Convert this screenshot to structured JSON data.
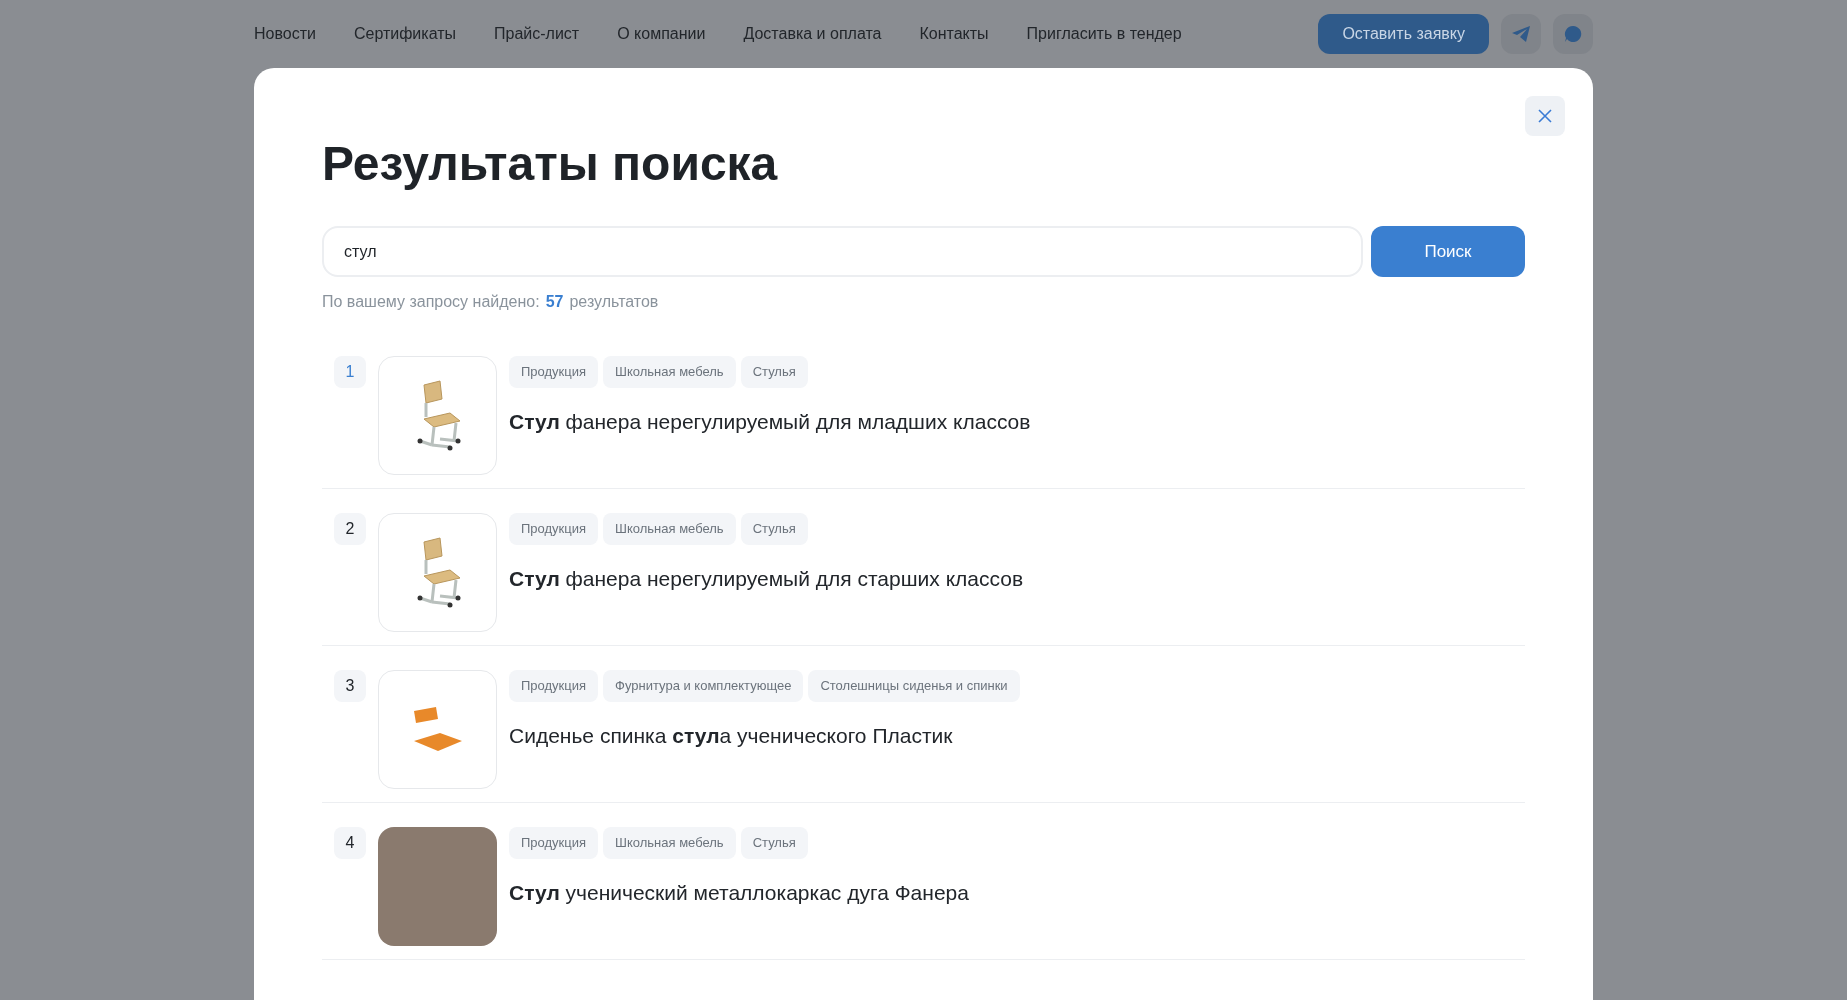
{
  "nav": {
    "items": [
      "Новости",
      "Сертификаты",
      "Прайс-лист",
      "О компании",
      "Доставка и оплата",
      "Контакты",
      "Пригласить в тендер"
    ],
    "cta": "Оставить заявку"
  },
  "modal": {
    "title": "Результаты поиска",
    "search": {
      "value": "стул",
      "button": "Поиск"
    },
    "summary": {
      "before": "По вашему запросу найдено:",
      "count": "57",
      "after": "результатов"
    },
    "results": [
      {
        "number": "1",
        "selected": true,
        "image": {
          "kind": "chair"
        },
        "tags": [
          "Продукция",
          "Школьная мебель",
          "Стулья"
        ],
        "title": "**Стул** фанера нерегулируемый для младших классов"
      },
      {
        "number": "2",
        "selected": false,
        "image": {
          "kind": "chair"
        },
        "tags": [
          "Продукция",
          "Школьная мебель",
          "Стулья"
        ],
        "title": "**Стул** фанера нерегулируемый для старших классов"
      },
      {
        "number": "3",
        "selected": false,
        "image": {
          "kind": "parts"
        },
        "tags": [
          "Продукция",
          "Фурнитура и комплектующее",
          "Столешницы сиденья и спинки"
        ],
        "title": "Сиденье спинка **стул**а ученического Пластик"
      },
      {
        "number": "4",
        "selected": false,
        "image": {
          "kind": "photo"
        },
        "tags": [
          "Продукция",
          "Школьная мебель",
          "Стулья"
        ],
        "title": "**Стул** ученический металлокаркас дуга Фанера"
      }
    ]
  }
}
